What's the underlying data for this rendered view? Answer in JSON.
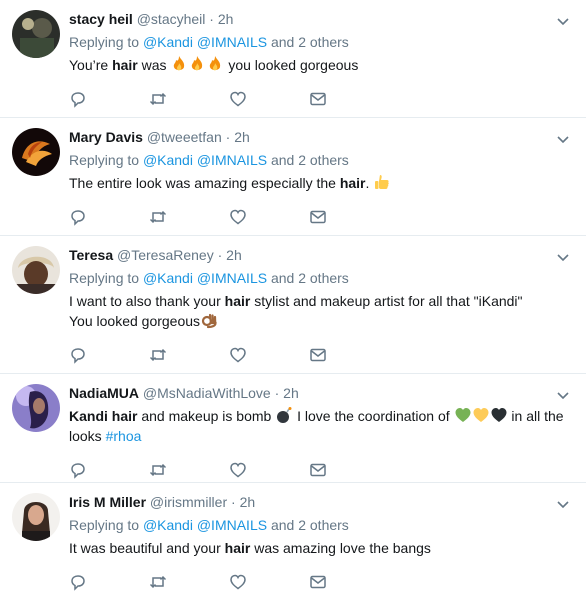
{
  "tweets": [
    {
      "name": "stacy heil",
      "handle": "@stacyheil",
      "time": "2h",
      "replying_prefix": "Replying to",
      "mentions": "@Kandi @IMNAILS",
      "others": "and 2 others",
      "text_a": "You’re ",
      "bold": "hair",
      "text_b": " was ",
      "text_c": "  you looked gorgeous",
      "emojis": [
        "fire",
        "fire",
        "fire"
      ]
    },
    {
      "name": "Mary Davis",
      "handle": "@tweeetfan",
      "time": "2h",
      "replying_prefix": "Replying to",
      "mentions": "@Kandi @IMNAILS",
      "others": "and 2 others",
      "text_a": "The entire look was amazing especially the ",
      "bold": "hair",
      "text_b": ". ",
      "emojis": [
        "thumbs-up"
      ]
    },
    {
      "name": "Teresa",
      "handle": "@TeresaReney",
      "time": "2h",
      "replying_prefix": "Replying to",
      "mentions": "@Kandi @IMNAILS",
      "others": "and 2 others",
      "text_a": "I want to also thank your ",
      "bold": "hair",
      "text_b": " stylist and makeup artist for all that \"iKandi\"",
      "text_line2": "You looked gorgeous",
      "emojis": [
        "ok-hand"
      ]
    },
    {
      "name": "NadiaMUA",
      "handle": "@MsNadiaWithLove",
      "time": "2h",
      "bold_a": "Kandi hair",
      "text_a": " and makeup is bomb ",
      "text_b": " I love the coordination of ",
      "text_c": " in all the",
      "text_line2": "looks ",
      "hashtag": "#rhoa",
      "emojis": [
        "bomb",
        "green-heart",
        "yellow-heart",
        "black-heart"
      ]
    },
    {
      "name": "Iris M Miller",
      "handle": "@irismmiller",
      "time": "2h",
      "replying_prefix": "Replying to",
      "mentions": "@Kandi @IMNAILS",
      "others": "and 2 others",
      "text_a": "It was beautiful and your ",
      "bold": "hair",
      "text_b": " was amazing love the bangs"
    }
  ],
  "colors": {
    "link": "#1b95e0",
    "muted": "#657786",
    "text": "#14171a",
    "divider": "#e6ecf0"
  },
  "icons": [
    "reply-icon",
    "retweet-icon",
    "like-icon",
    "dm-icon",
    "chevron-down-icon"
  ]
}
